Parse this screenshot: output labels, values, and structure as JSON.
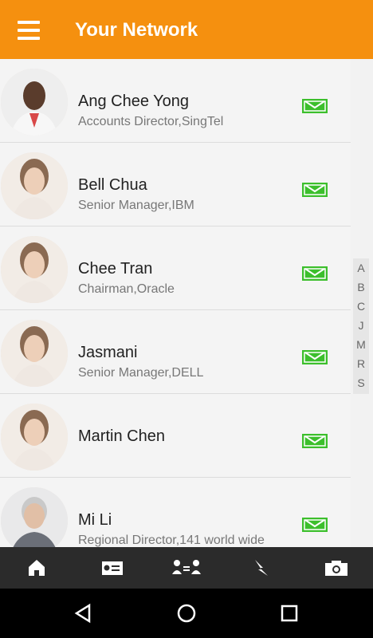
{
  "header": {
    "title": "Your Network"
  },
  "contacts": [
    {
      "name": "Ang Chee Yong",
      "subtitle": "Accounts Director,SingTel",
      "avatar_icon": "man-avatar-icon"
    },
    {
      "name": "Bell Chua",
      "subtitle": "Senior Manager,IBM",
      "avatar_icon": "woman-avatar-icon"
    },
    {
      "name": "Chee Tran",
      "subtitle": "Chairman,Oracle",
      "avatar_icon": "woman-avatar-icon"
    },
    {
      "name": "Jasmani",
      "subtitle": "Senior Manager,DELL",
      "avatar_icon": "woman-avatar-icon"
    },
    {
      "name": "Martin Chen",
      "subtitle": "",
      "avatar_icon": "woman-avatar-icon"
    },
    {
      "name": "Mi Li",
      "subtitle": "Regional Director,141 world wide",
      "avatar_icon": "elderly-man-avatar-icon"
    }
  ],
  "index_letters": [
    "A",
    "B",
    "C",
    "J",
    "M",
    "R",
    "S"
  ],
  "bottom_tabs": [
    "home-icon",
    "contact-card-icon",
    "connections-icon",
    "lightning-icon",
    "camera-icon"
  ],
  "system_nav": [
    "back-icon",
    "home-circle-icon",
    "recents-icon"
  ],
  "colors": {
    "header": "#f5900f",
    "mail": "#3cbf2c",
    "bottom_bar": "#2b2b2b"
  }
}
